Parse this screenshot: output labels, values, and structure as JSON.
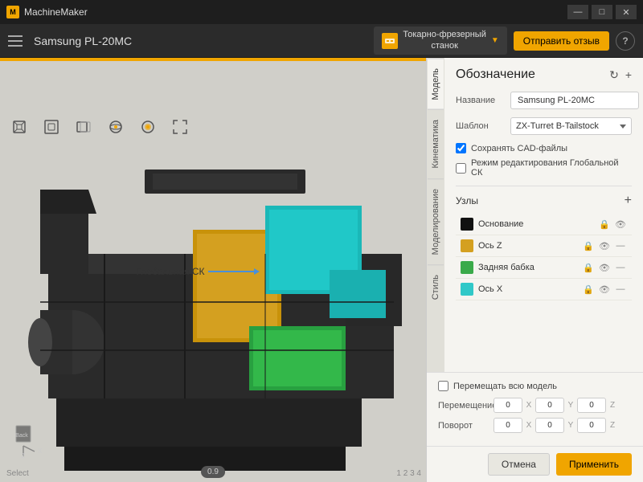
{
  "app": {
    "title": "MachineMaker",
    "logo_letter": "M"
  },
  "titlebar": {
    "machine_name": "Samsung PL-20MC",
    "minimize": "—",
    "maximize": "□",
    "close": "✕"
  },
  "topbar": {
    "machine_name": "Samsung PL-20MC",
    "machine_type_line1": "Токарно-фрезерный",
    "machine_type_line2": "станок",
    "feedback_btn": "Отправить отзыв",
    "help_btn": "?"
  },
  "viewport": {
    "coord_label": "Глобальная СК",
    "mode_badge": "0.9",
    "select_label": "Select",
    "version_label": "1 2 3 4"
  },
  "panel": {
    "section_title": "Обозначение",
    "refresh_btn": "↻",
    "add_btn": "+",
    "form": {
      "name_label": "Название",
      "name_value": "Samsung PL-20MC",
      "template_label": "Шаблон",
      "template_value": "ZX-Turret B-Tailstock",
      "save_cad_label": "Сохранять CAD-файлы",
      "edit_global_sk_label": "Режим редактирования Глобальной СК"
    },
    "nodes": {
      "title": "Узлы",
      "items": [
        {
          "name": "Основание",
          "color": "#2a2a2a",
          "color_display": "#111"
        },
        {
          "name": "Ось Z",
          "color": "#d4a020",
          "color_display": "#d4a020"
        },
        {
          "name": "Задняя бабка",
          "color": "#3aaa4a",
          "color_display": "#3aaa4a"
        },
        {
          "name": "Ось X",
          "color": "#30c8c8",
          "color_display": "#30c8c8"
        }
      ]
    },
    "move_all_label": "Перемещать всю модель",
    "move_label": "Перемещение",
    "rotate_label": "Поворот",
    "move_values": {
      "x": "0",
      "y": "0",
      "z": "0"
    },
    "rotate_values": {
      "x": "0",
      "y": "0",
      "z": "0"
    },
    "cancel_btn": "Отмена",
    "apply_btn": "Применить"
  },
  "vertical_tabs": [
    {
      "id": "model",
      "label": "Модель",
      "active": true
    },
    {
      "id": "kinematics",
      "label": "Кинематика",
      "active": false
    },
    {
      "id": "modeling",
      "label": "Моделирование",
      "active": false
    },
    {
      "id": "style",
      "label": "Стиль",
      "active": false
    }
  ]
}
